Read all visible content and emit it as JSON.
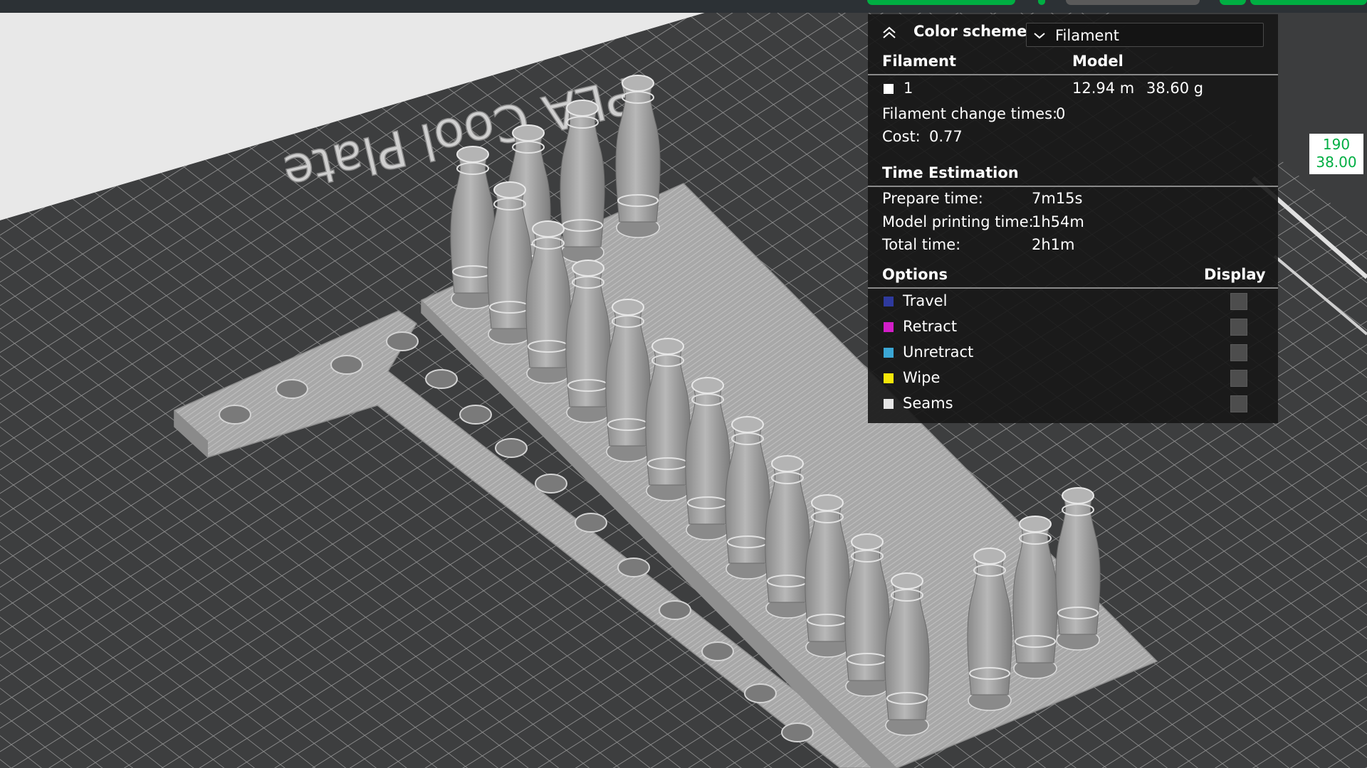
{
  "viewport": {
    "plate_label": "PLA Cool Plate",
    "colors": {
      "bed": "#3c3d3e",
      "bed_grid": "#a8a8a8",
      "plate_edge": "#dcdcdc",
      "model": "#a6a6a6",
      "model_dark": "#6f6f6f",
      "accent": "#00ae42"
    }
  },
  "legend": {
    "header": {
      "collapse_icon": "chevron-up-icon",
      "label": "Color scheme",
      "select_icon": "chevron-down-icon",
      "selected": "Filament"
    },
    "filament_header": {
      "col1": "Filament",
      "col2": "Model"
    },
    "filament": {
      "id": "1",
      "swatch_color": "#ffffff",
      "length": "12.94 m",
      "weight": "38.60 g"
    },
    "change_times_label": "Filament change times:",
    "change_times_value": "0",
    "cost_label": "Cost:",
    "cost_value": "0.77",
    "time_header": "Time Estimation",
    "times": [
      {
        "label": "Prepare time:",
        "value": "7m15s"
      },
      {
        "label": "Model printing time:",
        "value": "1h54m"
      },
      {
        "label": "Total time:",
        "value": "2h1m"
      }
    ],
    "options_header": {
      "col1": "Options",
      "col2": "Display"
    },
    "options": [
      {
        "label": "Travel",
        "color": "#2e3a9e"
      },
      {
        "label": "Retract",
        "color": "#d21ec8"
      },
      {
        "label": "Unretract",
        "color": "#3ba6d4"
      },
      {
        "label": "Wipe",
        "color": "#f5e60a"
      },
      {
        "label": "Seams",
        "color": "#e6e6e6"
      }
    ]
  },
  "height_tooltip": {
    "layer": "190",
    "height": "38.00"
  }
}
